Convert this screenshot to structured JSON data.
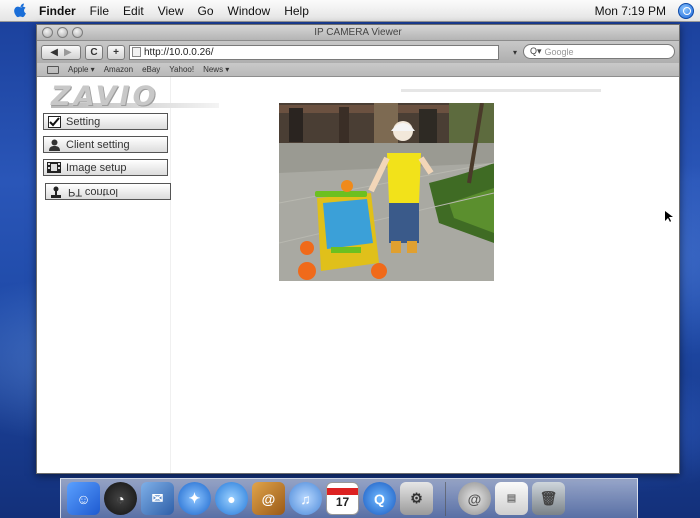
{
  "menubar": {
    "apple_icon": "apple-icon",
    "items": [
      "Finder",
      "File",
      "Edit",
      "View",
      "Go",
      "Window",
      "Help"
    ],
    "clock": "Mon 7:19 PM",
    "spotlight_icon": "spotlight-icon"
  },
  "browser": {
    "title": "IP CAMERA Viewer",
    "url": "http://10.0.0.26/",
    "search_placeholder": "Google",
    "reload_glyph": "C",
    "add_glyph": "+",
    "bookmarks": [
      "Apple ▾",
      "Amazon",
      "eBay",
      "Yahoo!",
      "News ▾"
    ]
  },
  "page": {
    "logo": "ZAVIO",
    "sidebar_buttons": [
      {
        "label": "Setting",
        "icon": "checkbox-icon"
      },
      {
        "label": "Client setting",
        "icon": "user-icon"
      },
      {
        "label": "Image setup",
        "icon": "film-icon"
      },
      {
        "label": "PT control",
        "icon": "joystick-icon"
      }
    ],
    "camera_feed": "live-camera-image"
  },
  "dock": {
    "items": [
      "finder-icon",
      "dashboard-icon",
      "mail-icon",
      "safari-icon",
      "ichat-icon",
      "addressbook-icon",
      "itunes-icon",
      "ical-icon",
      "quicktime-icon",
      "system-preferences-icon",
      "mail-server-icon",
      "preview-icon",
      "trash-icon"
    ],
    "calendar_day": "17"
  },
  "colors": {
    "desktop_blue": "#1f4aa8",
    "window_chrome": "#b4b4b4"
  }
}
